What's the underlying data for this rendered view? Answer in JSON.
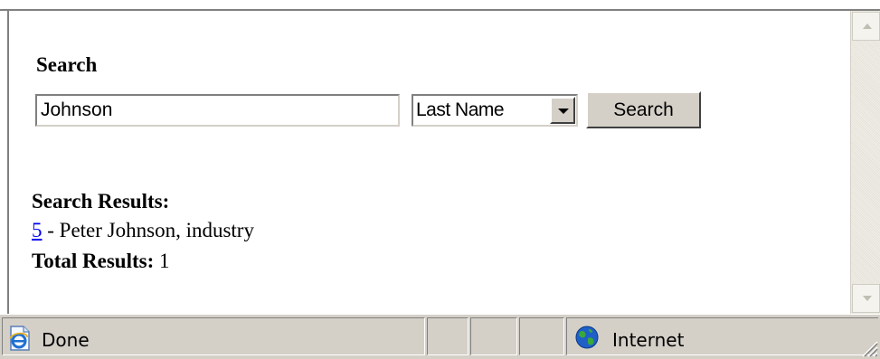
{
  "page": {
    "search_heading": "Search",
    "search_input": {
      "value": "Johnson",
      "placeholder": ""
    },
    "search_field_select": {
      "selected": "Last Name"
    },
    "search_button_label": "Search",
    "results_heading": "Search Results:",
    "results": [
      {
        "id_link": "5",
        "text": " - Peter Johnson, industry"
      }
    ],
    "total_label": "Total Results:",
    "total_value": "1"
  },
  "status_bar": {
    "status_text": "Done",
    "zone_text": "Internet",
    "icons": [
      "ie-page-icon",
      "globe-icon",
      "resize-grip-icon"
    ]
  },
  "scrollbar": {
    "icons": [
      "scroll-up-arrow-icon",
      "scroll-down-arrow-icon"
    ]
  }
}
